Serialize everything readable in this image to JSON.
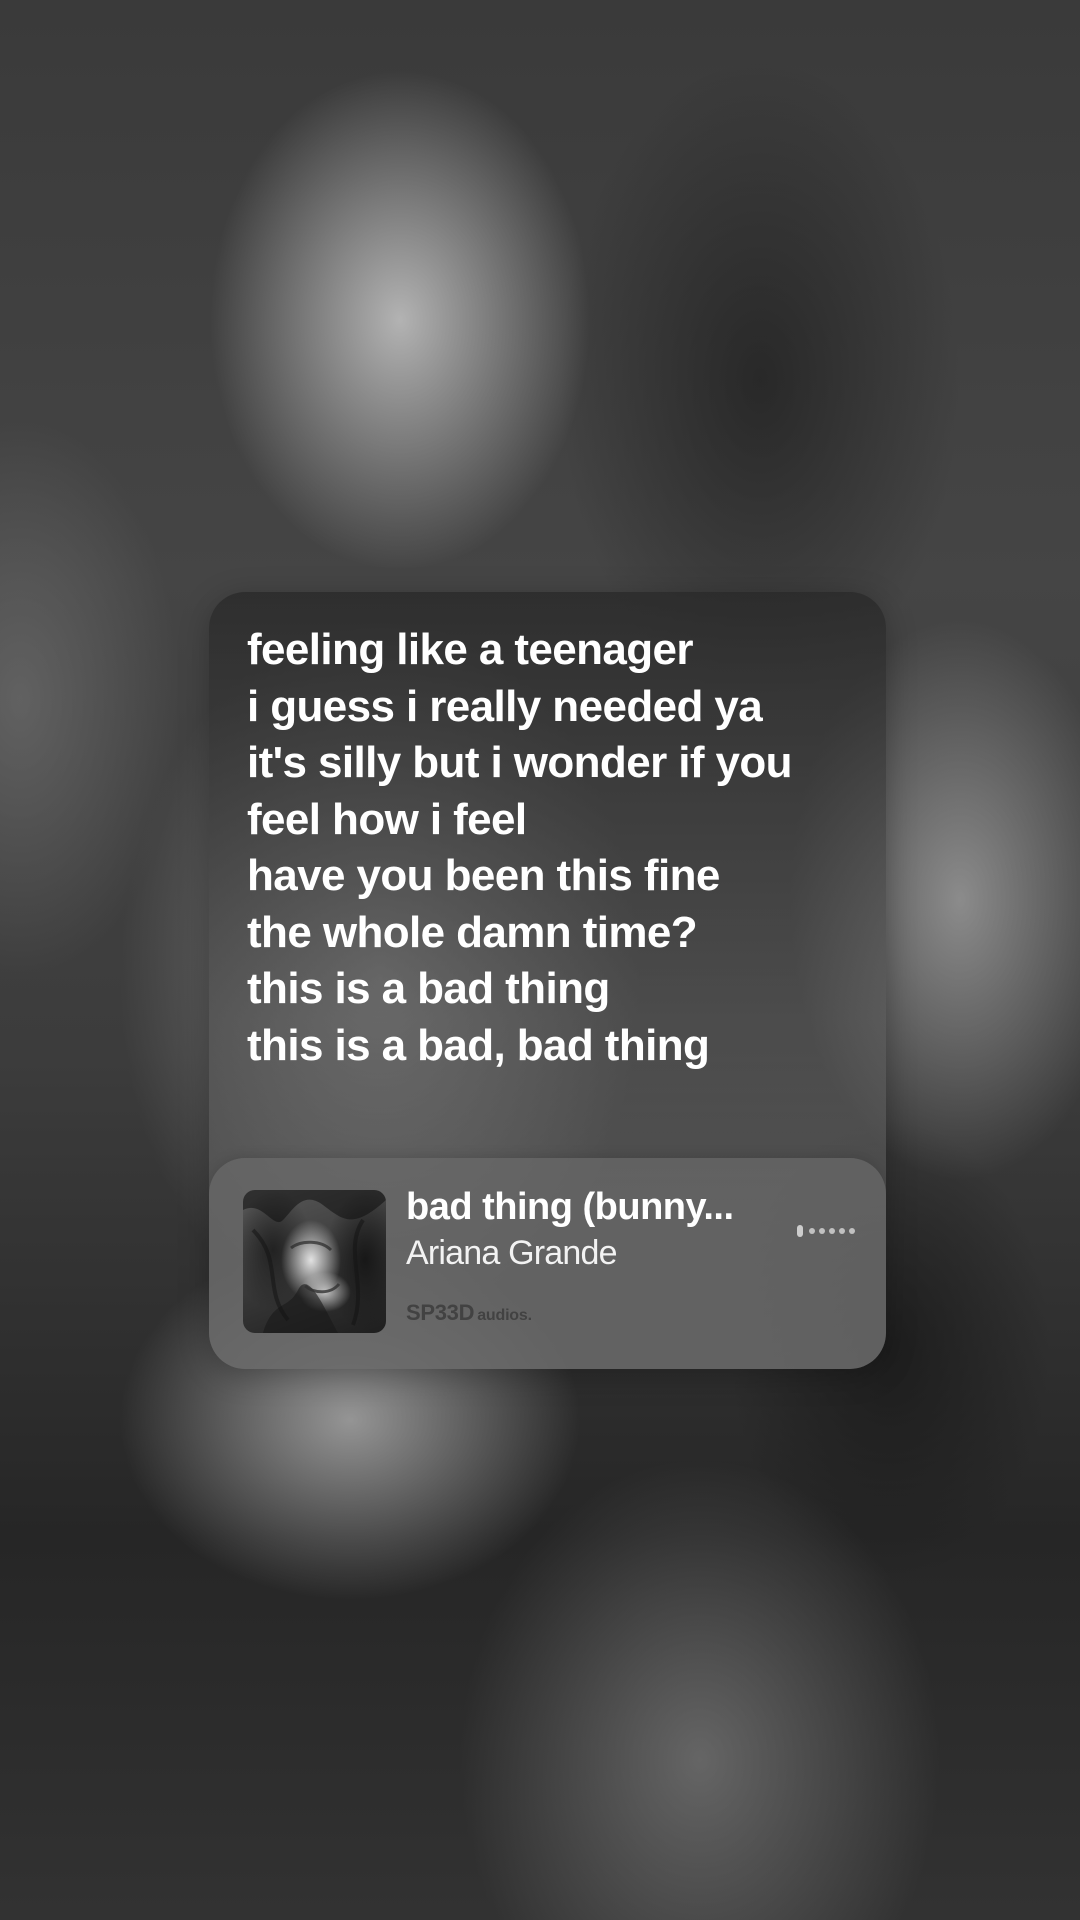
{
  "lyrics": [
    "feeling like a teenager",
    "i guess i really needed ya",
    "it's silly but i wonder if you",
    "feel how i feel",
    "have you been this fine",
    "the whole damn time?",
    "this is a bad thing",
    "this is a bad, bad thing"
  ],
  "player": {
    "title": "bad thing (bunny...",
    "artist": "Ariana Grande",
    "brand_main": "SP33D",
    "brand_sub": "audios.",
    "album_art_icon": "album-cover-image",
    "progress_icon": "playback-progress-dots-icon"
  },
  "colors": {
    "text": "#ffffff",
    "card": "#4a4a4a",
    "player_bg": "#696969"
  }
}
